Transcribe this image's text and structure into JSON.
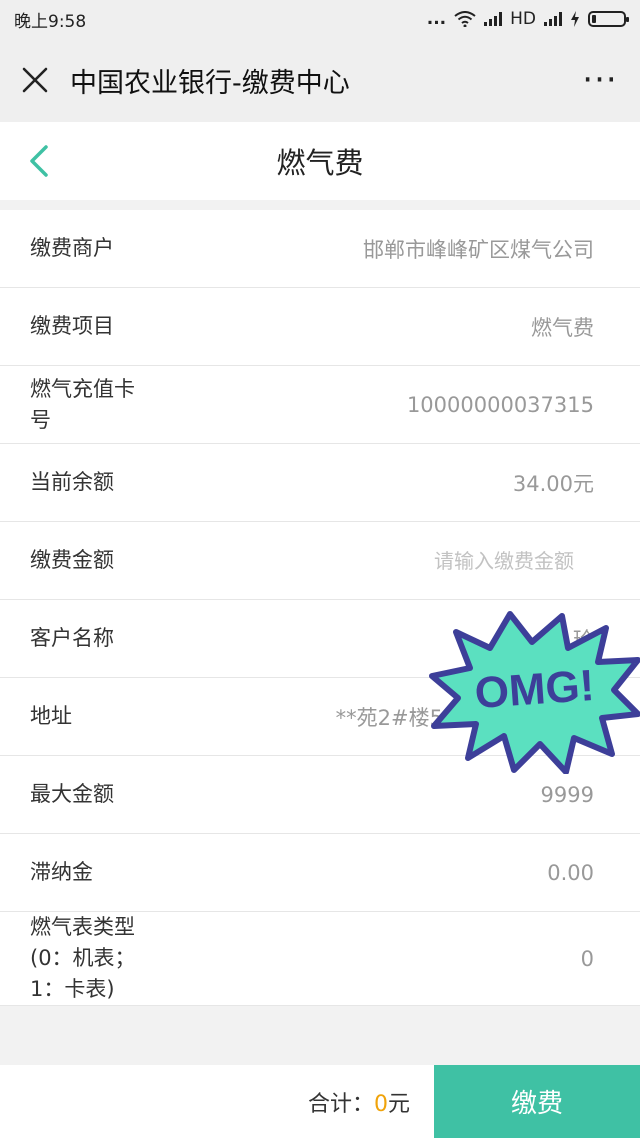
{
  "status_bar": {
    "time": "晚上9:58",
    "dots": "...",
    "network": "HD"
  },
  "top_bar": {
    "close_icon": "close-icon",
    "title": "中国农业银行-缴费中心",
    "more_icon": "more-icon",
    "more_glyph": "···"
  },
  "nav": {
    "back_icon": "chevron-left-icon",
    "title": "燃气费",
    "accent_color": "#3fc1a4"
  },
  "rows": [
    {
      "label": "缴费商户",
      "value": "邯郸市峰峰矿区煤气公司"
    },
    {
      "label": "缴费项目",
      "value": "燃气费"
    },
    {
      "label": "燃气充值卡号",
      "value": "10000000037315"
    },
    {
      "label": "当前余额",
      "value": "34.00元"
    },
    {
      "label": "缴费金额",
      "value": "",
      "placeholder": "请输入缴费金额"
    },
    {
      "label": "客户名称",
      "value": "玲"
    },
    {
      "label": "地址",
      "value": "**苑2#楼5单"
    },
    {
      "label": "最大金额",
      "value": "9999"
    },
    {
      "label": "滞纳金",
      "value": "0.00"
    },
    {
      "label": "燃气表类型(0：机表；1：卡表)",
      "value": "0"
    }
  ],
  "sticker": {
    "text": "OMG!"
  },
  "bottom": {
    "total_label": "合计：",
    "total_amount": "0",
    "total_unit": "元",
    "pay_button": "缴费",
    "amount_color": "#f0a30a",
    "button_color": "#3fc1a4"
  }
}
